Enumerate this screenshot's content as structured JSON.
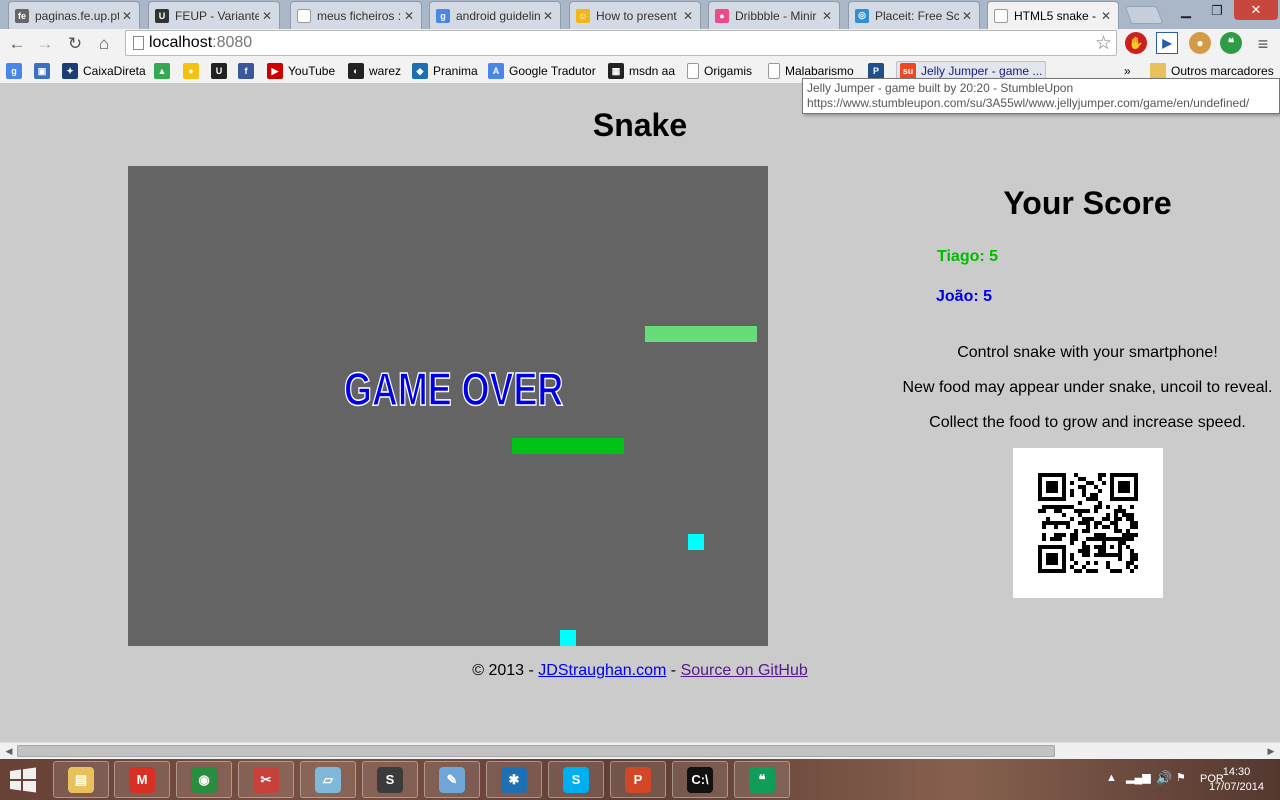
{
  "browser": {
    "tabs": [
      {
        "title": "paginas.fe.up.pt",
        "favicon_color": "#666666",
        "favicon_text": "fe"
      },
      {
        "title": "FEUP - Variantes",
        "favicon_color": "#333333",
        "favicon_text": "U"
      },
      {
        "title": "meus ficheiros :",
        "favicon_color": "#ffffff",
        "favicon_text": ""
      },
      {
        "title": "android guidelin",
        "favicon_color": "#4a86e8",
        "favicon_text": "g"
      },
      {
        "title": "How to present",
        "favicon_color": "#f2b61b",
        "favicon_text": "☺"
      },
      {
        "title": "Dribbble - Minir",
        "favicon_color": "#ea4c89",
        "favicon_text": "●"
      },
      {
        "title": "Placeit: Free Scr",
        "favicon_color": "#2d8fd5",
        "favicon_text": "◎"
      },
      {
        "title": "HTML5 snake - ",
        "favicon_color": "",
        "favicon_text": ""
      }
    ],
    "tab_close_glyph": "✕",
    "url_host": "localhost",
    "url_port": ":8080",
    "bookmarks": [
      {
        "label": "",
        "icon_color": "#4a86e8",
        "icon_text": "g"
      },
      {
        "label": "",
        "icon_color": "#3b6fc2",
        "icon_text": "▣"
      },
      {
        "label": "CaixaDireta",
        "icon_color": "#1c3f73",
        "icon_text": "✦"
      },
      {
        "label": "",
        "icon_color": "#34a853",
        "icon_text": "▲"
      },
      {
        "label": "",
        "icon_color": "#f4c20d",
        "icon_text": "●"
      },
      {
        "label": "",
        "icon_color": "#222222",
        "icon_text": "U"
      },
      {
        "label": "",
        "icon_color": "#3b5998",
        "icon_text": "f"
      },
      {
        "label": "YouTube",
        "icon_color": "#cc0000",
        "icon_text": "▶"
      },
      {
        "label": "warez",
        "icon_color": "#222222",
        "icon_text": "◐"
      },
      {
        "label": "Pranima",
        "icon_color": "#1a6fb3",
        "icon_text": "◆"
      },
      {
        "label": "Google Tradutor",
        "icon_color": "#4a86e8",
        "icon_text": "A"
      },
      {
        "label": "msdn aa",
        "icon_color": "#222222",
        "icon_text": "▦"
      },
      {
        "label": "Origamis",
        "icon_color": "#ffffff",
        "icon_text": ""
      },
      {
        "label": "Malabarismo",
        "icon_color": "#ffffff",
        "icon_text": ""
      },
      {
        "label": "",
        "icon_color": "#1f4e8c",
        "icon_text": "P"
      },
      {
        "label": "Jelly Jumper - game ...",
        "icon_color": "#eb4924",
        "icon_text": "su"
      }
    ],
    "bookmarks_overflow": "»",
    "other_bookmarks": "Outros marcadores",
    "tooltip_line1": "Jelly Jumper - game built by 20:20 - StumbleUpon",
    "tooltip_line2": "https://www.stumbleupon.com/su/3A55wl/www.jellyjumper.com/game/en/undefined/"
  },
  "page": {
    "title": "Snake",
    "game_over_text": "GAME OVER",
    "score_heading": "Your Score",
    "players": [
      {
        "label": "Tiago: 5",
        "color": "#00bb00"
      },
      {
        "label": "João: 5",
        "color": "#0000dd"
      }
    ],
    "instructions": [
      "Control snake with your smartphone!",
      "New food may appear under snake, uncoil to reveal.",
      "Collect the food to grow and increase speed."
    ],
    "footer": {
      "copyright": "© 2013 - ",
      "link1": "JDStraughan.com",
      "separator": " - ",
      "link2": "Source on GitHub"
    }
  },
  "taskbar": {
    "apps": [
      {
        "name": "file-explorer",
        "color": "#e8c15a",
        "glyph": "▤"
      },
      {
        "name": "gmail",
        "color": "#d93025",
        "glyph": "M"
      },
      {
        "name": "chrome",
        "color": "#2a8c3e",
        "glyph": "◉"
      },
      {
        "name": "snipping-tool",
        "color": "#c7403a",
        "glyph": "✂"
      },
      {
        "name": "notepad",
        "color": "#7fb8d8",
        "glyph": "▱"
      },
      {
        "name": "sublime-text",
        "color": "#3b3b3b",
        "glyph": "S"
      },
      {
        "name": "paint",
        "color": "#6fa6d6",
        "glyph": "✎"
      },
      {
        "name": "sourcetree",
        "color": "#1f6fb5",
        "glyph": "✱"
      },
      {
        "name": "skype",
        "color": "#00aff0",
        "glyph": "S"
      },
      {
        "name": "powerpoint",
        "color": "#d24726",
        "glyph": "P"
      },
      {
        "name": "command-prompt",
        "color": "#111111",
        "glyph": "C:\\"
      },
      {
        "name": "hangouts",
        "color": "#0f9d58",
        "glyph": "❝"
      }
    ],
    "language": "POR",
    "time": "14:30",
    "date": "17/07/2014"
  }
}
